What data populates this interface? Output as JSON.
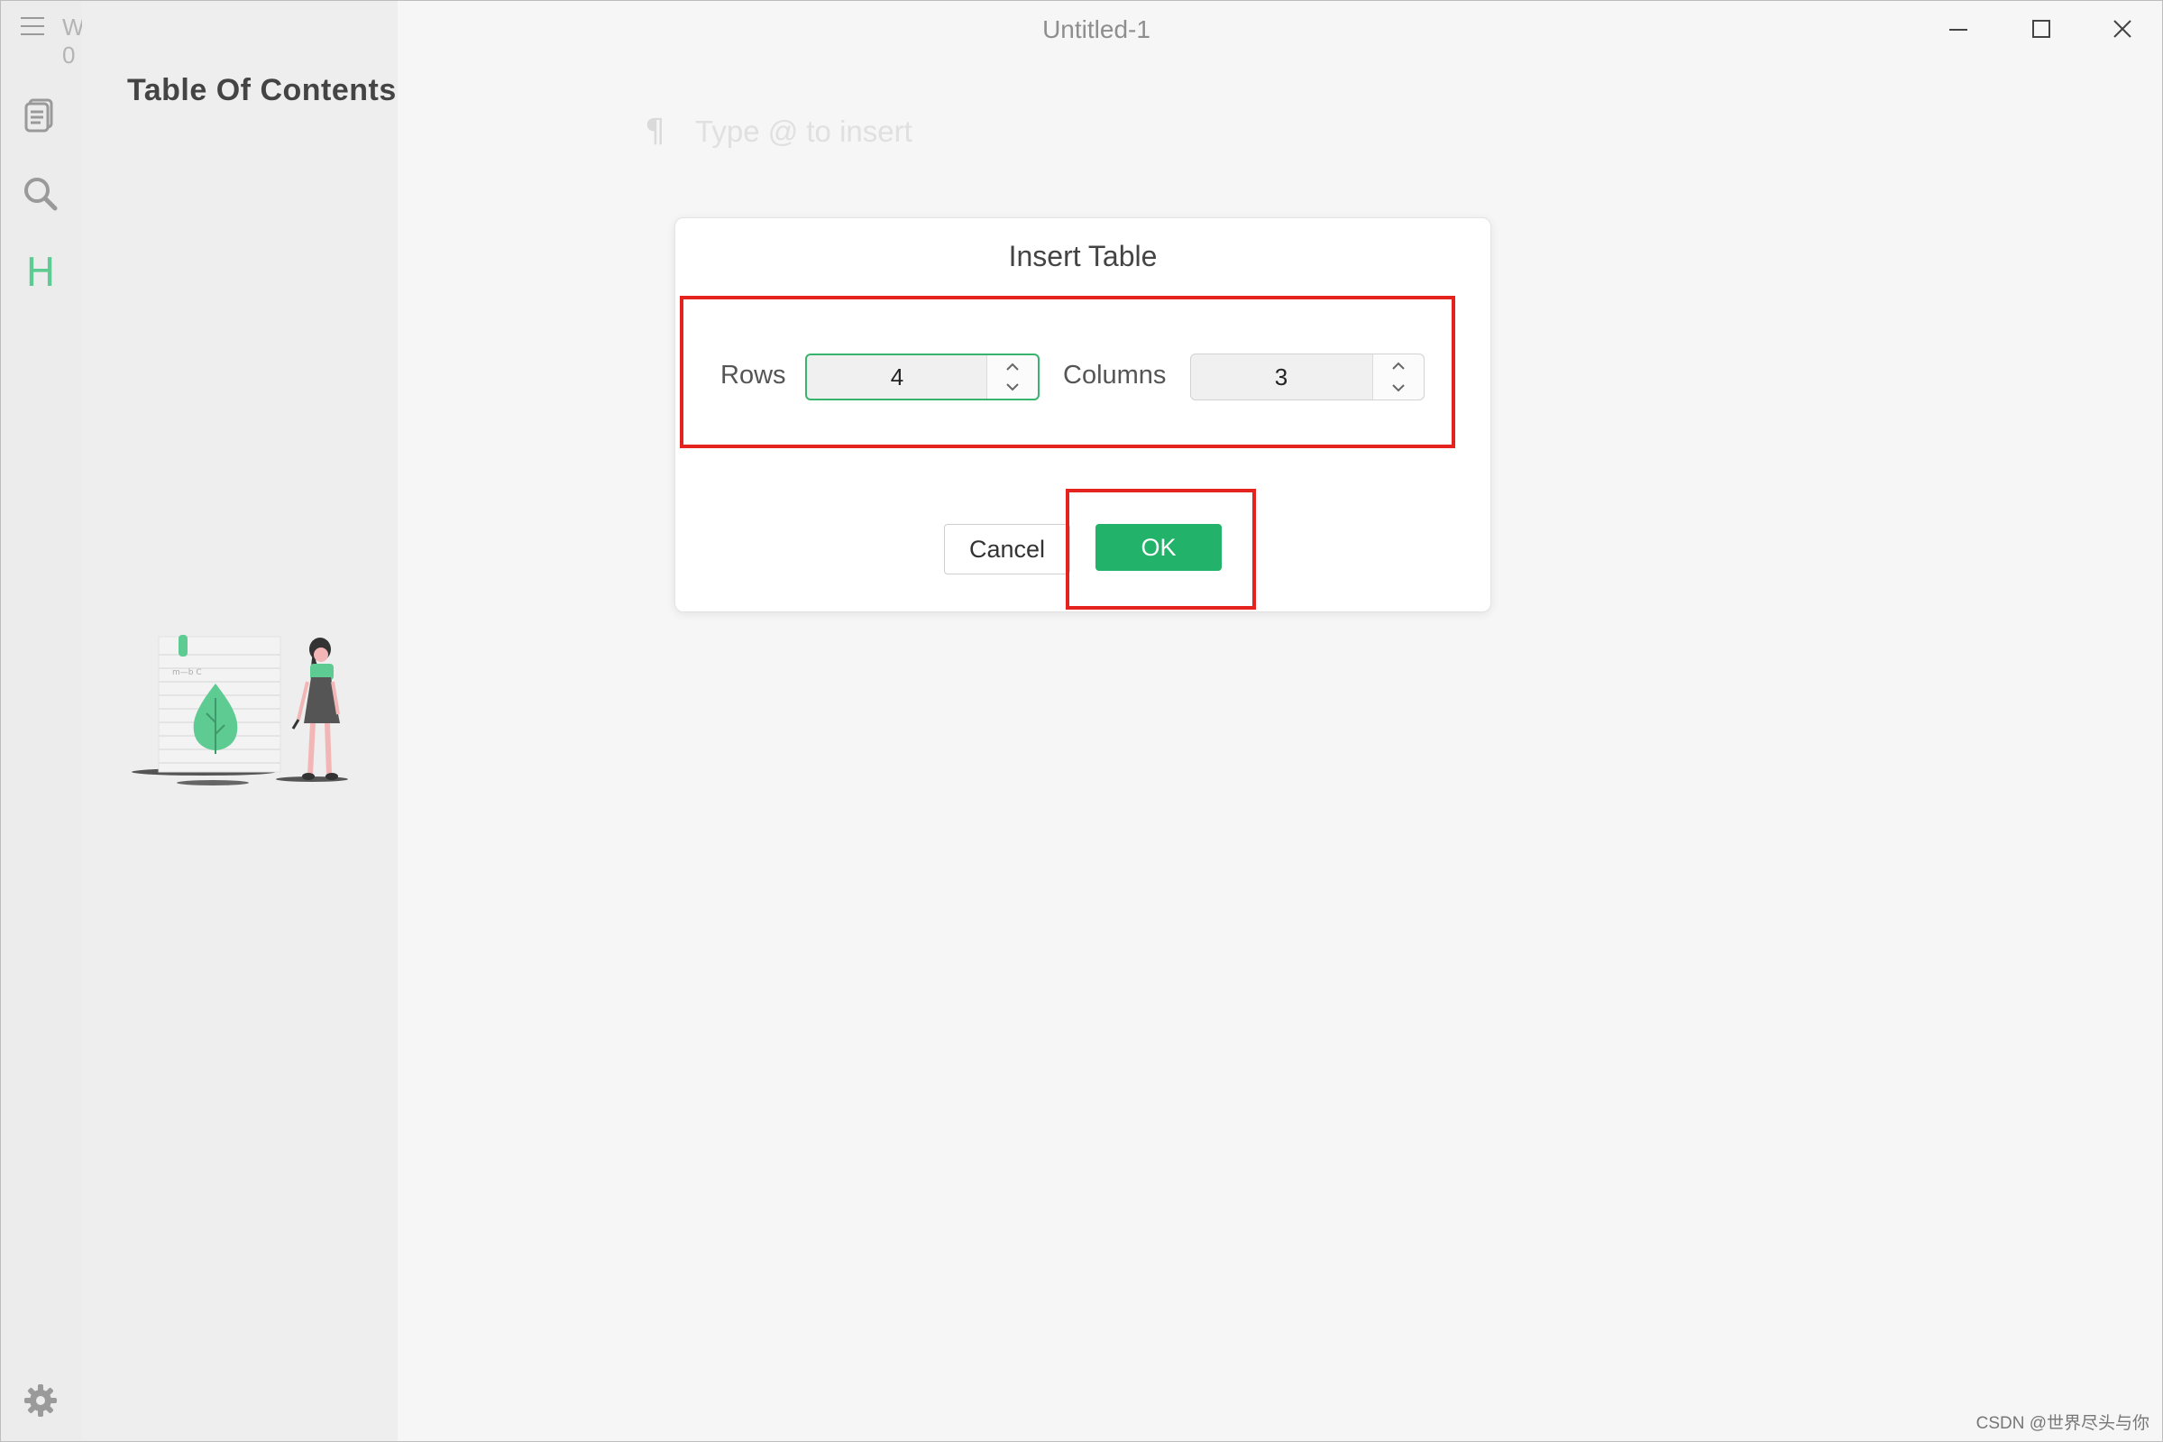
{
  "window": {
    "title": "Untitled-1",
    "word_count": "W 0"
  },
  "sidebar": {
    "panel_title": "Table Of Contents",
    "icons": [
      "menu-icon",
      "files-icon",
      "search-icon",
      "toc-heading-icon",
      "gear-icon"
    ],
    "toc_icon_glyph": "H",
    "illustration_label": "m—b C"
  },
  "editor": {
    "paragraph_glyph": "¶",
    "placeholder": "Type @ to insert"
  },
  "dialog": {
    "title": "Insert Table",
    "rows_label": "Rows",
    "rows_value": "4",
    "columns_label": "Columns",
    "columns_value": "3",
    "cancel_label": "Cancel",
    "ok_label": "OK"
  },
  "colors": {
    "accent_green": "#23b26a",
    "highlight_red": "#e5231e",
    "focus_green": "#39b46d"
  },
  "watermark": "CSDN @世界尽头与你"
}
